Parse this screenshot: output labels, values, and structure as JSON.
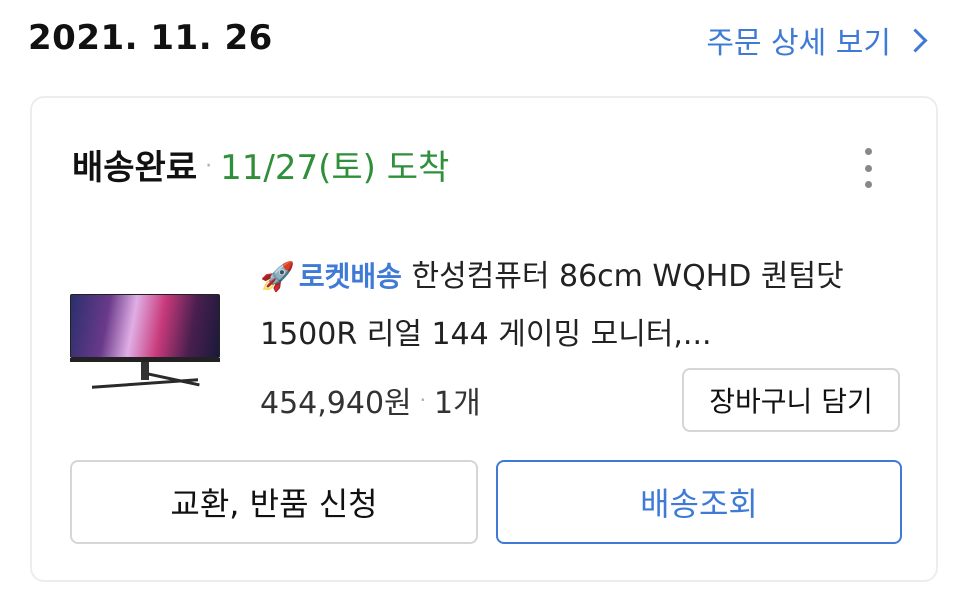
{
  "header": {
    "order_date": "2021. 11. 26",
    "detail_link": "주문 상세 보기"
  },
  "card": {
    "status": "배송완료",
    "arrival": "11/27(토) 도착",
    "product": {
      "badge": "로켓배송",
      "title": "한성컴퓨터 86cm WQHD 퀀텀닷 1500R 리얼 144 게이밍 모니터,...",
      "price": "454,940원",
      "quantity": "1개",
      "thumbnail_icon": "monitor-image"
    },
    "cart_button": "장바구니 담기",
    "return_button": "교환, 반품 신청",
    "track_button": "배송조회"
  },
  "colors": {
    "accent_blue": "#3f7bd6",
    "status_green": "#2f8f3a"
  }
}
